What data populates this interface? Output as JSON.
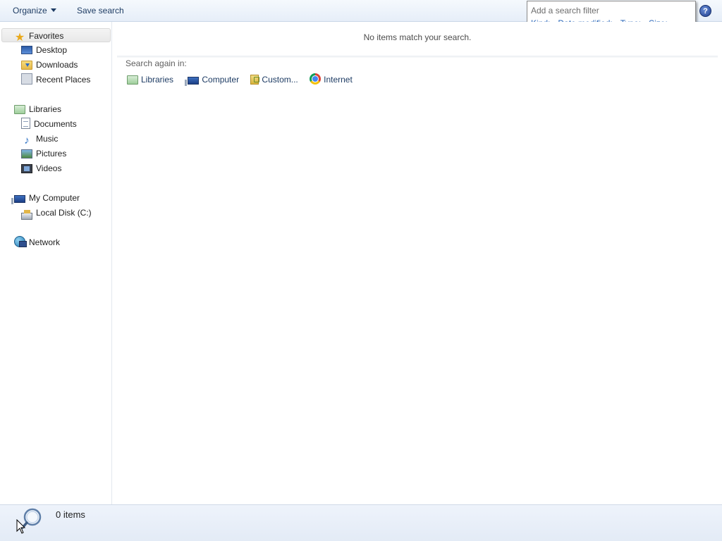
{
  "toolbar": {
    "organize_label": "Organize",
    "save_search_label": "Save search",
    "help_label": "?"
  },
  "search_filter": {
    "title": "Add a search filter",
    "options": [
      "Kind:",
      "Date modified:",
      "Type:",
      "Size:"
    ]
  },
  "nav": {
    "favorites": {
      "label": "Favorites",
      "items": [
        "Desktop",
        "Downloads",
        "Recent Places"
      ]
    },
    "libraries": {
      "label": "Libraries",
      "items": [
        "Documents",
        "Music",
        "Pictures",
        "Videos"
      ]
    },
    "computer": {
      "label": "My Computer",
      "items": [
        "Local Disk (C:)"
      ]
    },
    "network": {
      "label": "Network"
    }
  },
  "content": {
    "empty_message": "No items match your search.",
    "search_again_label": "Search again in:",
    "search_again_links": [
      "Libraries",
      "Computer",
      "Custom...",
      "Internet"
    ]
  },
  "status": {
    "item_count": "0 items"
  }
}
